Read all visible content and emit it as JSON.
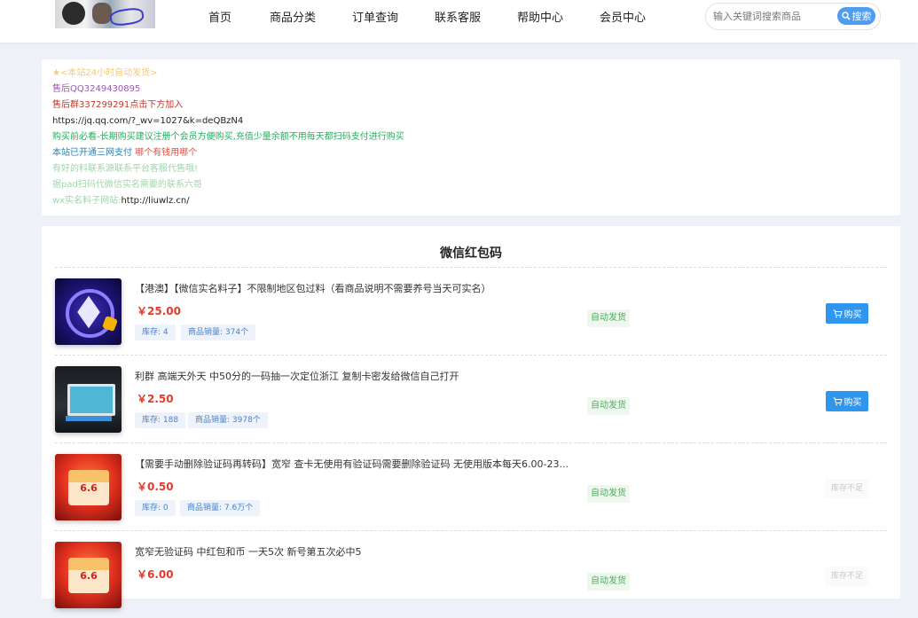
{
  "nav": {
    "items": [
      {
        "label": "首页"
      },
      {
        "label": "商品分类"
      },
      {
        "label": "订单查询"
      },
      {
        "label": "联系客服"
      },
      {
        "label": "帮助中心"
      },
      {
        "label": "会员中心"
      }
    ]
  },
  "search": {
    "placeholder": "输入关键词搜索商品",
    "button_label": "搜索"
  },
  "notice": {
    "lines": [
      {
        "text": "★<本站24小时自动发货>",
        "color": "#f3c879"
      },
      {
        "text": "售后QQ3249430895",
        "color": "#9b59b6"
      },
      {
        "text": "售后群337299291点击下方加入",
        "color": "#c0392b"
      },
      {
        "text": "https://jq.qq.com/?_wv=1027&k=deQBzN4",
        "color": "#222222"
      },
      {
        "text": "购买前必看-长期购买建议注册个会员方便购买,充值少量余额不用每天都扫码支付进行购买",
        "color": "#27ae60"
      },
      {
        "text": "本站已开通三网支付",
        "color": "#2980b9",
        "suffix": " 哪个有钱用哪个",
        "suffix_color": "#e74c3c"
      },
      {
        "text": "有好的料联系源联系平台客服代售哦!",
        "color": "#9fd6a8"
      },
      {
        "text": "据pad扫码代微信实名需要的联系六哥",
        "color": "#9fd6a8"
      },
      {
        "text": "wx实名料子网站:",
        "color": "#9fd6a8",
        "suffix": "http://liuwlz.cn/",
        "suffix_color": "#222222"
      }
    ]
  },
  "section": {
    "title": "微信红包码"
  },
  "products": [
    {
      "title": "【港澳】【微信实名料子】不限制地区包过料（看商品说明不需要养号当天可实名）",
      "price": "￥25.00",
      "stock": "库存: 4",
      "sales": "商品销量: 374个",
      "delivery": "自动发货",
      "action": "购买",
      "available": true,
      "image": "cube-icon"
    },
    {
      "title": "利群 高端天外天 中50分的一码抽一次定位浙江 复制卡密发给微信自己打开",
      "price": "￥2.50",
      "stock": "库存: 188",
      "sales": "商品销量: 3978个",
      "delivery": "自动发货",
      "action": "购买",
      "available": true,
      "image": "phone-screen-icon"
    },
    {
      "title": "【需要手动删除验证码再转码】宽窄 查卡无使用有验证码需要删除验证码 无使用版本每天6.00-23...",
      "price": "￥0.50",
      "stock": "库存: 0",
      "sales": "商品销量: 7.6万个",
      "delivery": "自动发货",
      "action": "库存不足",
      "available": false,
      "image": "red-packet-icon",
      "image_text": "6.6"
    },
    {
      "title": "宽窄无验证码 中红包和币 一天5次 新号第五次必中5",
      "price": "￥6.00",
      "stock": "",
      "sales": "",
      "delivery": "自动发货",
      "action": "库存不足",
      "available": false,
      "image": "red-packet-icon",
      "image_text": "6.6"
    }
  ]
}
